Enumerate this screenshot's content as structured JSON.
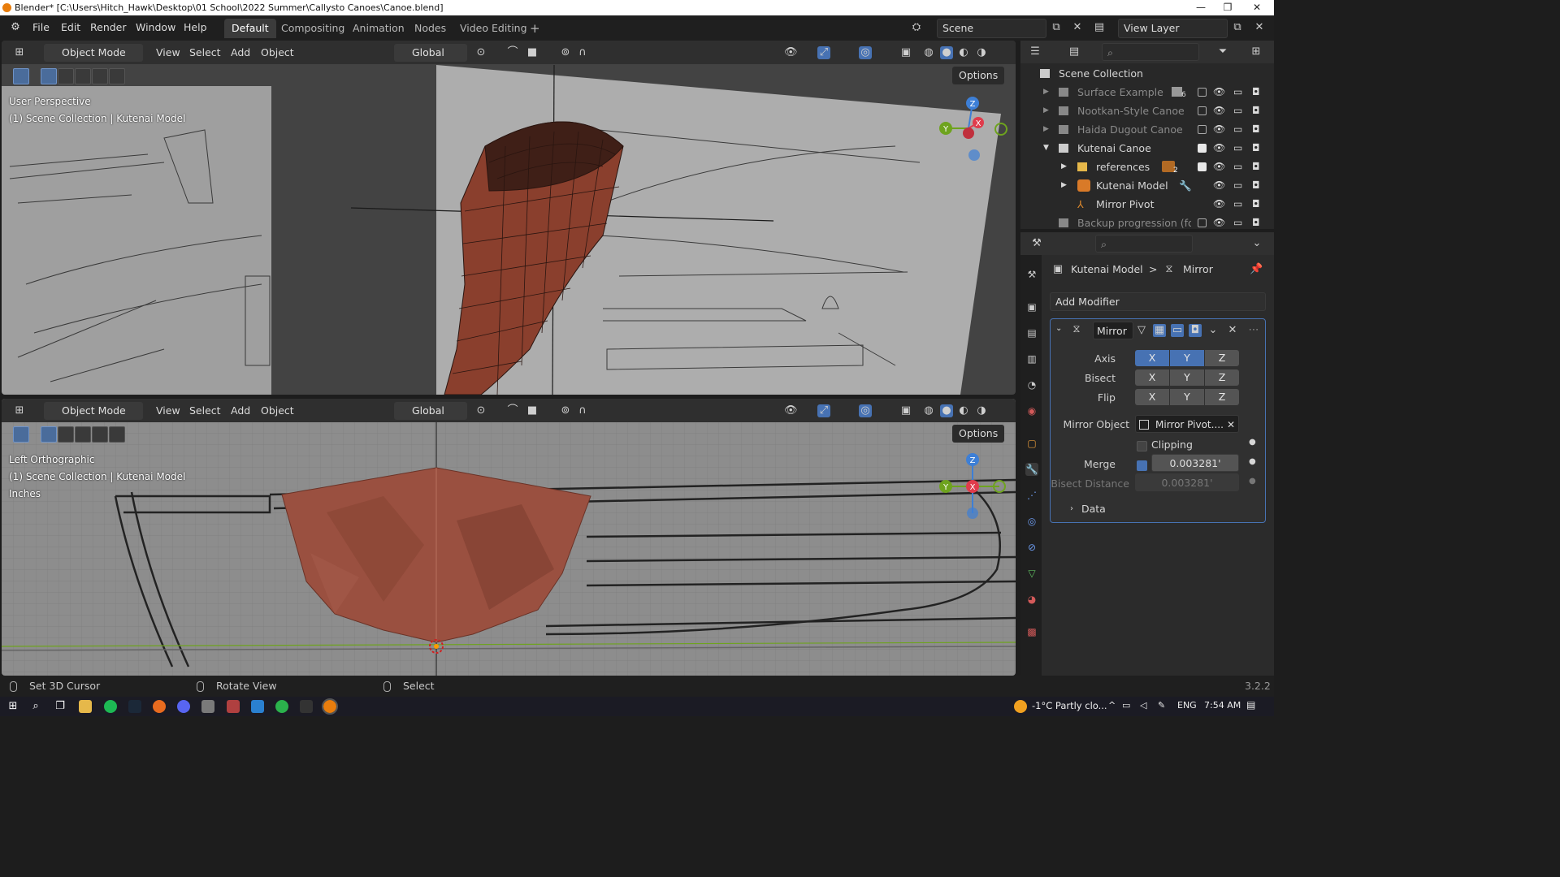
{
  "window": {
    "title": "Blender* [C:\\Users\\Hitch_Hawk\\Desktop\\01 School\\2022 Summer\\Callysto Canoes\\Canoe.blend]",
    "minimize": "—",
    "maximize": "❐",
    "close": "✕"
  },
  "menu": [
    "File",
    "Edit",
    "Render",
    "Window",
    "Help"
  ],
  "workspaces": [
    "Default",
    "Compositing",
    "Animation",
    "Nodes",
    "Video Editing"
  ],
  "add_workspace": "+",
  "scene": {
    "label": "Scene"
  },
  "view_layer": {
    "label": "View Layer"
  },
  "viewport_top": {
    "mode": "Object Mode",
    "menus": [
      "View",
      "Select",
      "Add",
      "Object"
    ],
    "orientation": "Global",
    "options": "Options",
    "view_name": "User Perspective",
    "collection": "(1) Scene Collection | Kutenai Model"
  },
  "viewport_bottom": {
    "mode": "Object Mode",
    "menus": [
      "View",
      "Select",
      "Add",
      "Object"
    ],
    "orientation": "Global",
    "options": "Options",
    "view_name": "Left Orthographic",
    "collection": "(1) Scene Collection | Kutenai Model",
    "units": "Inches"
  },
  "gizmo": {
    "x": "X",
    "y": "Y",
    "z": "Z"
  },
  "outliner": {
    "root": "Scene Collection",
    "rows": [
      {
        "label": "Surface Example",
        "badge": "6",
        "dim": true
      },
      {
        "label": "Nootkan-Style Canoe",
        "dim": true
      },
      {
        "label": "Haida Dugout Canoe",
        "dim": true
      },
      {
        "label": "Kutenai Canoe",
        "dim": false
      },
      {
        "label": "references",
        "badge": "2",
        "dim": false
      },
      {
        "label": "Kutenai Model",
        "dim": false
      },
      {
        "label": "Mirror Pivot",
        "dim": false
      },
      {
        "label": "Backup progression (for sc",
        "dim": true
      }
    ]
  },
  "properties": {
    "breadcrumb_object": "Kutenai Model",
    "breadcrumb_sep": ">",
    "breadcrumb_modifier": "Mirror",
    "add_modifier": "Add Modifier",
    "modifier_name": "Mirror",
    "axis_label": "Axis",
    "bisect_label": "Bisect",
    "flip_label": "Flip",
    "x": "X",
    "y": "Y",
    "z": "Z",
    "mirror_object_label": "Mirror Object",
    "mirror_object_value": "Mirror Pivot....",
    "clipping_label": "Clipping",
    "merge_label": "Merge",
    "merge_value": "0.003281'",
    "bisect_distance_label": "Bisect Distance",
    "bisect_distance_value": "0.003281'",
    "data_label": "Data"
  },
  "status": {
    "left": "Set 3D Cursor",
    "middle": "Rotate View",
    "right": "Select",
    "version": "3.2.2"
  },
  "taskbar": {
    "weather": "-1°C  Partly clo...",
    "lang": "ENG",
    "time": "7:54 AM"
  },
  "colors": {
    "accent": "#4772b3",
    "blender_orange": "#e87d0d",
    "canoe": "#8a3f2d",
    "gizmo_x": "#e03c4c",
    "gizmo_y": "#6ea31e",
    "gizmo_z": "#3d7fd6"
  }
}
